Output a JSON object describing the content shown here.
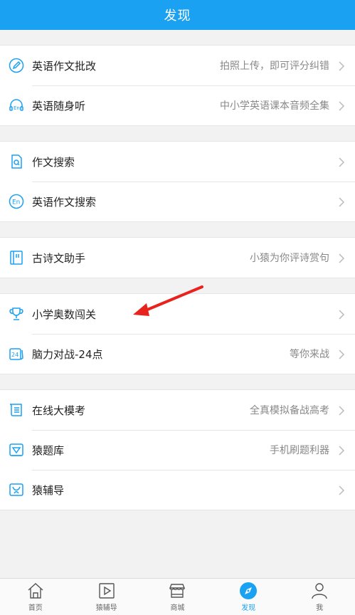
{
  "header": {
    "title": "发现"
  },
  "groups": [
    {
      "rows": [
        {
          "label": "英语作文批改",
          "desc": "拍照上传，即可评分纠错"
        },
        {
          "label": "英语随身听",
          "desc": "中小学英语课本音频全集"
        }
      ]
    },
    {
      "rows": [
        {
          "label": "作文搜索",
          "desc": ""
        },
        {
          "label": "英语作文搜索",
          "desc": ""
        }
      ]
    },
    {
      "rows": [
        {
          "label": "古诗文助手",
          "desc": "小猿为你评诗赏句"
        }
      ]
    },
    {
      "rows": [
        {
          "label": "小学奥数闯关",
          "desc": ""
        },
        {
          "label": "脑力对战-24点",
          "desc": "等你来战"
        }
      ]
    },
    {
      "rows": [
        {
          "label": "在线大模考",
          "desc": "全真模拟备战高考"
        },
        {
          "label": "猿题库",
          "desc": "手机刷题利器"
        },
        {
          "label": "猿辅导",
          "desc": ""
        }
      ]
    }
  ],
  "icons": {
    "g0r1": "24",
    "accent": "#1aa1f2"
  },
  "tabbar": {
    "items": [
      {
        "label": "首页"
      },
      {
        "label": "猿辅导"
      },
      {
        "label": "商城"
      },
      {
        "label": "发现"
      },
      {
        "label": "我"
      }
    ]
  }
}
